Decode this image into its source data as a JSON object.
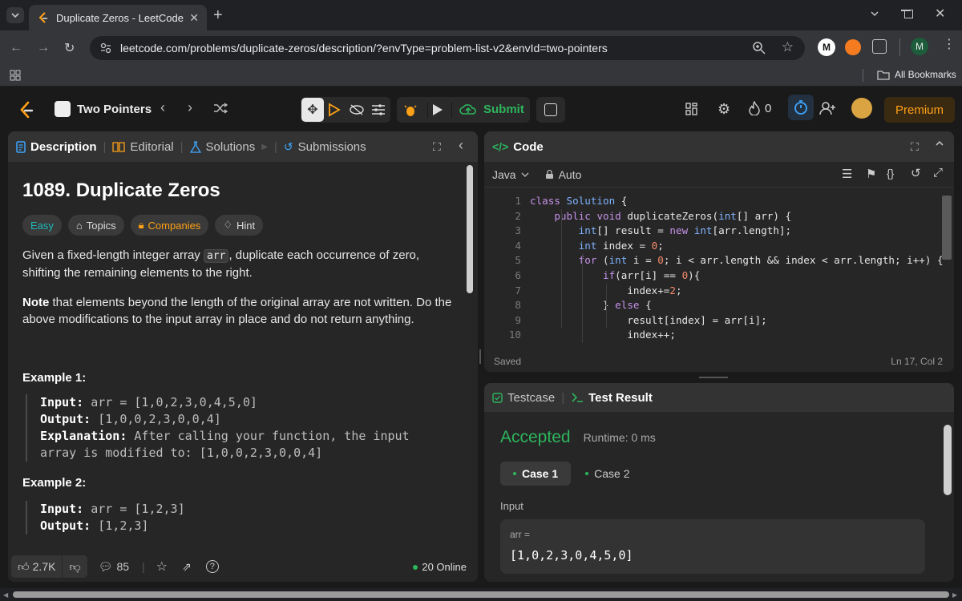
{
  "browser": {
    "tab_title": "Duplicate Zeros - LeetCode",
    "url": "leetcode.com/problems/duplicate-zeros/description/?envType=problem-list-v2&envId=two-pointers",
    "bookmarks_label": "All Bookmarks",
    "profile_initial": "M",
    "ext_initial": "M"
  },
  "nav": {
    "problem_list": "Two Pointers",
    "submit_label": "Submit",
    "streak_count": "0",
    "premium_label": "Premium"
  },
  "description": {
    "tabs": [
      "Description",
      "Editorial",
      "Solutions",
      "Submissions"
    ],
    "title": "1089. Duplicate Zeros",
    "difficulty": "Easy",
    "tags": [
      "Topics",
      "Companies",
      "Hint"
    ],
    "para1_a": "Given a fixed-length integer array ",
    "para1_code": "arr",
    "para1_b": ", duplicate each occurrence of zero, shifting the remaining elements to the right.",
    "para2_bold": "Note",
    "para2_rest": " that elements beyond the length of the original array are not written. Do the above modifications to the input array in place and do not return anything.",
    "example1": {
      "heading": "Example 1:",
      "input_label": "Input:",
      "input": " arr = [1,0,2,3,0,4,5,0]",
      "output_label": "Output:",
      "output": " [1,0,0,2,3,0,0,4]",
      "expl_label": "Explanation:",
      "expl": " After calling your function, the input array is modified to: [1,0,0,2,3,0,0,4]"
    },
    "example2": {
      "heading": "Example 2:",
      "input_label": "Input:",
      "input": " arr = [1,2,3]",
      "output_label": "Output:",
      "output": " [1,2,3]"
    },
    "footer": {
      "likes": "2.7K",
      "comments": "85",
      "online": "20 Online"
    }
  },
  "code": {
    "header": "Code",
    "language": "Java",
    "mode": "Auto",
    "status": "Saved",
    "cursor": "Ln 17, Col 2",
    "lines": [
      "class Solution {",
      "    public void duplicateZeros(int[] arr) {",
      "        int[] result = new int[arr.length];",
      "        int index = 0;",
      "        for (int i = 0; i < arr.length && index < arr.length; i++) {",
      "            if(arr[i] == 0){",
      "                index+=2;",
      "            } else {",
      "                result[index] = arr[i];",
      "                index++;"
    ]
  },
  "result": {
    "tabs": [
      "Testcase",
      "Test Result"
    ],
    "verdict": "Accepted",
    "runtime": "Runtime: 0 ms",
    "cases": [
      "Case 1",
      "Case 2"
    ],
    "input_label": "Input",
    "var_name": "arr =",
    "var_value": "[1,0,2,3,0,4,5,0]"
  },
  "colors": {
    "accepted": "#2db55d",
    "easy": "#1cbaba",
    "companies": "#ffa116",
    "premium": "#ffa116"
  }
}
